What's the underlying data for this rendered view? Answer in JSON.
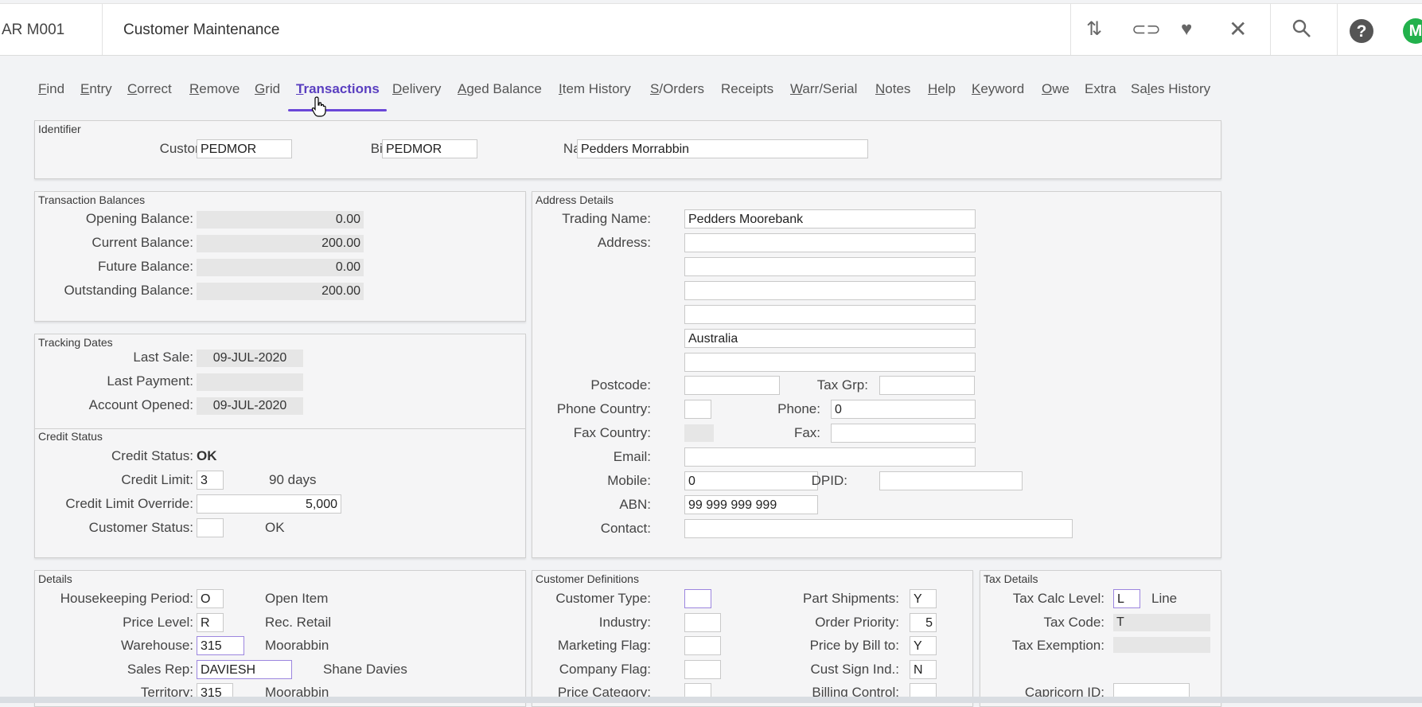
{
  "header": {
    "program_code": "AR M001",
    "window_title": "Customer Maintenance",
    "icons": [
      "sort-icon",
      "attachment-icon",
      "favorite-icon",
      "close-icon",
      "search-icon",
      "help-icon"
    ],
    "avatar_initial": "M"
  },
  "menu": [
    {
      "pre": "",
      "u": "F",
      "post": "ind"
    },
    {
      "pre": "",
      "u": "E",
      "post": "ntry"
    },
    {
      "pre": "",
      "u": "C",
      "post": "orrect"
    },
    {
      "pre": "",
      "u": "R",
      "post": "emove"
    },
    {
      "pre": "",
      "u": "G",
      "post": "rid"
    },
    {
      "pre": "",
      "u": "T",
      "post": "ransactions"
    },
    {
      "pre": "",
      "u": "D",
      "post": "elivery"
    },
    {
      "pre": "",
      "u": "A",
      "post": "ged Balance"
    },
    {
      "pre": "",
      "u": "I",
      "post": "tem History"
    },
    {
      "pre": "",
      "u": "S",
      "post": "/Orders"
    },
    {
      "pre": "",
      "u": "",
      "post": "Receipts"
    },
    {
      "pre": "",
      "u": "W",
      "post": "arr/Serial"
    },
    {
      "pre": "",
      "u": "N",
      "post": "otes"
    },
    {
      "pre": "",
      "u": "H",
      "post": "elp"
    },
    {
      "pre": "",
      "u": "K",
      "post": "eyword"
    },
    {
      "pre": "",
      "u": "O",
      "post": "we"
    },
    {
      "pre": "",
      "u": "",
      "post": "Extra"
    },
    {
      "pre": "Sa",
      "u": "l",
      "post": "es History"
    }
  ],
  "identifier": {
    "title": "Identifier",
    "customer_label": "Customer:",
    "customer": "PEDMOR",
    "billto_label": "Bill to:",
    "billto": "PEDMOR",
    "name_label": "Name:",
    "name": "Pedders Morrabbin"
  },
  "balances": {
    "title": "Transaction Balances",
    "opening_label": "Opening Balance:",
    "opening": "0.00",
    "current_label": "Current Balance:",
    "current": "200.00",
    "future_label": "Future Balance:",
    "future": "0.00",
    "outstanding_label": "Outstanding Balance:",
    "outstanding": "200.00"
  },
  "tracking": {
    "title": "Tracking Dates",
    "last_sale_label": "Last Sale:",
    "last_sale": "09-JUL-2020",
    "last_payment_label": "Last Payment:",
    "last_payment": "",
    "opened_label": "Account Opened:",
    "opened": "09-JUL-2020"
  },
  "credit": {
    "title": "Credit Status",
    "status_label": "Credit Status:",
    "status": "OK",
    "limit_label": "Credit Limit:",
    "limit": "3",
    "limit_desc": "90 days",
    "override_label": "Credit Limit Override:",
    "override": "5,000",
    "cust_status_label": "Customer Status:",
    "cust_status": "",
    "cust_status_desc": "OK"
  },
  "address": {
    "title": "Address Details",
    "trading_label": "Trading Name:",
    "trading": "Pedders Moorebank",
    "address_label": "Address:",
    "lines": [
      "",
      "",
      "",
      "",
      "Australia",
      ""
    ],
    "postcode_label": "Postcode:",
    "postcode": "",
    "taxgrp_label": "Tax Grp:",
    "taxgrp": "",
    "phone_country_label": "Phone Country:",
    "phone_country": "",
    "phone_label": "Phone:",
    "phone": "0",
    "fax_country_label": "Fax Country:",
    "fax_country": "",
    "fax_label": "Fax:",
    "fax": "",
    "email_label": "Email:",
    "email": "",
    "mobile_label": "Mobile:",
    "mobile": "0",
    "dpid_label": "DPID:",
    "dpid": "",
    "abn_label": "ABN:",
    "abn": "99 999 999 999",
    "contact_label": "Contact:",
    "contact": ""
  },
  "details": {
    "title": "Details",
    "hk_label": "Housekeeping Period:",
    "hk": "O",
    "hk_desc": "Open Item",
    "price_label": "Price Level:",
    "price": "R",
    "price_desc": "Rec. Retail",
    "wh_label": "Warehouse:",
    "wh": "315",
    "wh_desc": "Moorabbin",
    "rep_label": "Sales Rep:",
    "rep": "DAVIESH",
    "rep_desc": "Shane Davies",
    "terr_label": "Territory:",
    "terr": "315",
    "terr_desc": "Moorabbin"
  },
  "custdef": {
    "title": "Customer Definitions",
    "type_label": "Customer Type:",
    "type": "",
    "industry_label": "Industry:",
    "industry": "",
    "marketing_label": "Marketing Flag:",
    "marketing": "",
    "company_label": "Company Flag:",
    "company": "",
    "pricecat_label": "Price Category:",
    "pricecat": "",
    "partship_label": "Part Shipments:",
    "partship": "Y",
    "priority_label": "Order Priority:",
    "priority": "5",
    "pricebill_label": "Price by Bill to:",
    "pricebill": "Y",
    "sign_label": "Cust Sign Ind.:",
    "sign": "N",
    "billing_label": "Billing Control:",
    "billing": ""
  },
  "tax": {
    "title": "Tax Details",
    "calc_label": "Tax Calc Level:",
    "calc": "L",
    "calc_desc": "Line",
    "code_label": "Tax Code:",
    "code": "T",
    "exempt_label": "Tax Exemption:",
    "exempt": "",
    "capricorn_label": "Capricorn ID:",
    "capricorn": ""
  }
}
